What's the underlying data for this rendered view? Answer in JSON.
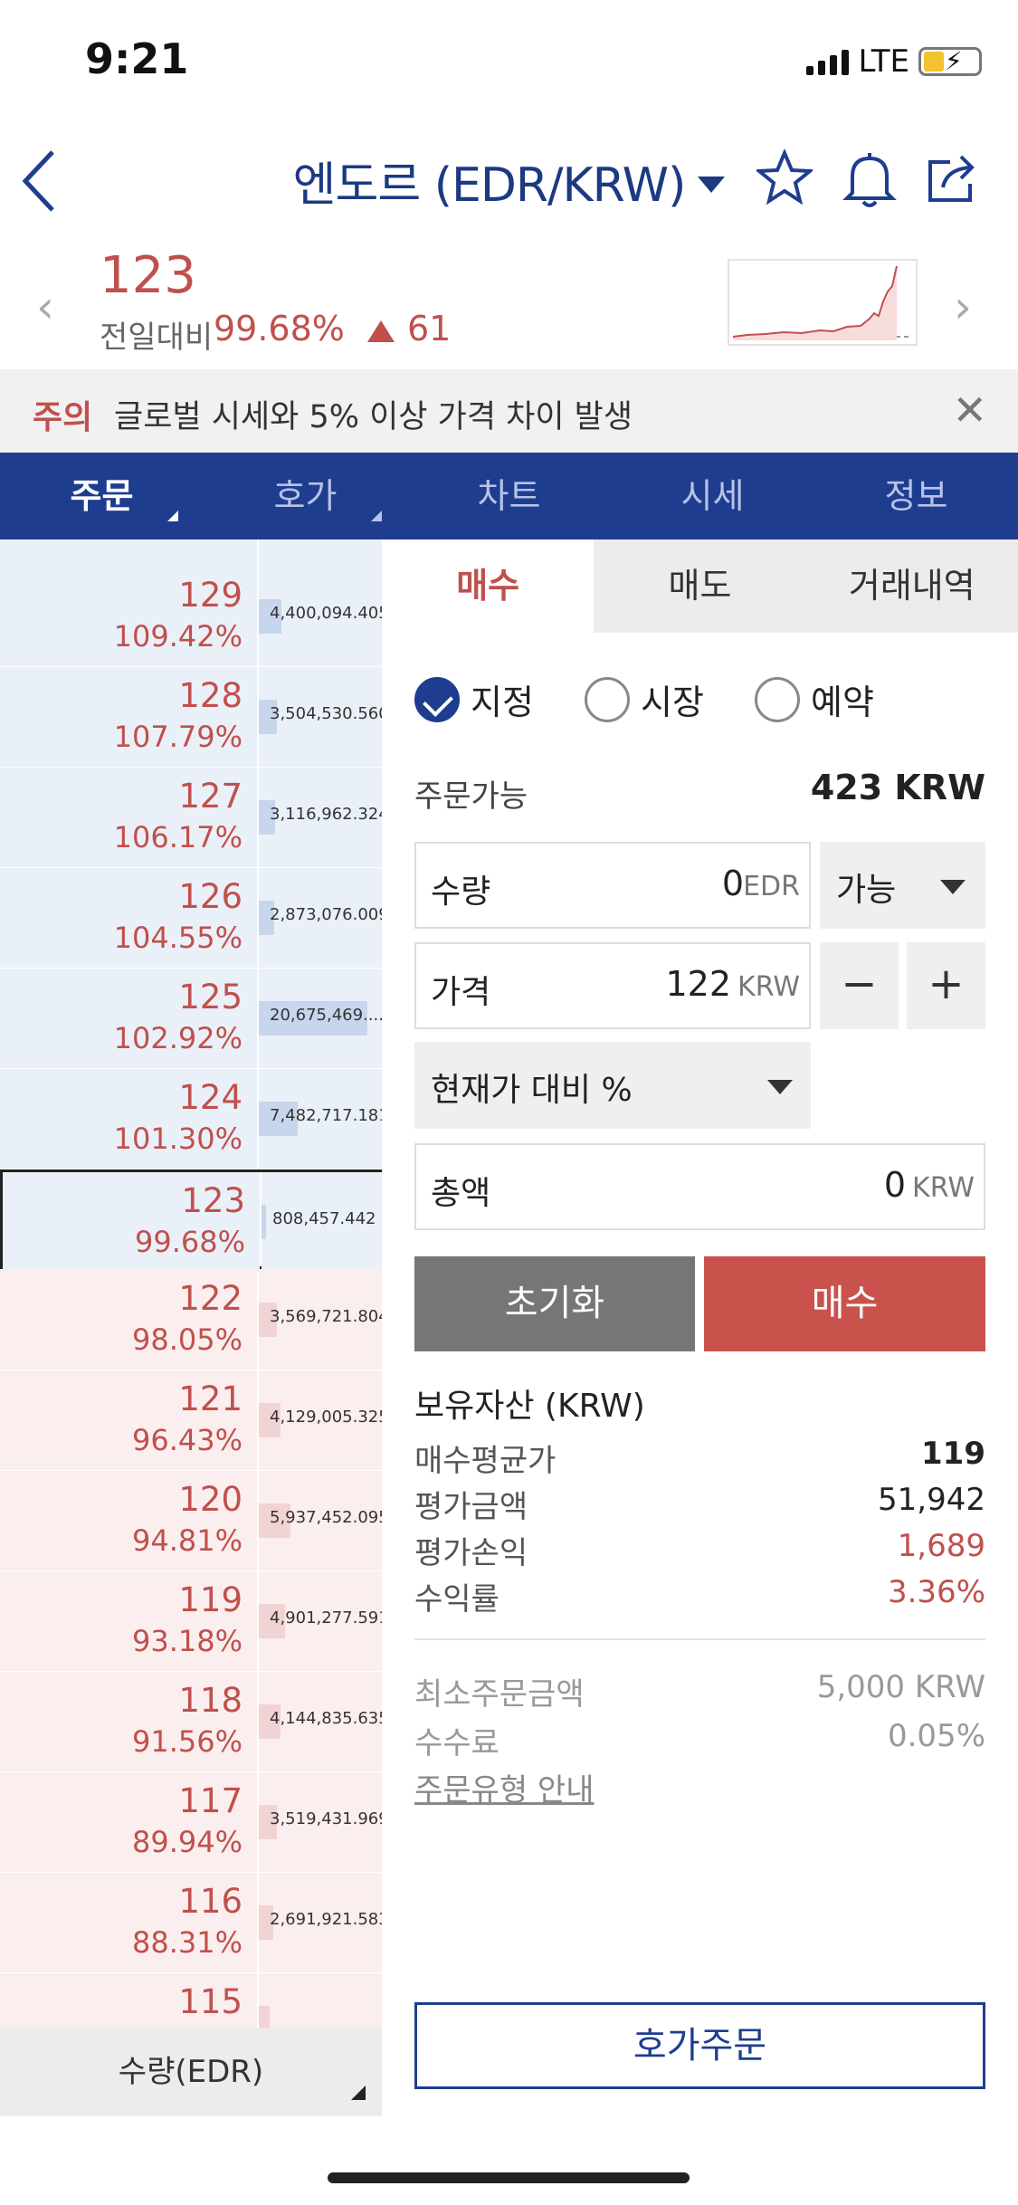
{
  "status_bar": {
    "time": "9:21",
    "network": "LTE"
  },
  "header": {
    "title": "엔도르 (EDR/KRW)"
  },
  "price_summary": {
    "price": "123",
    "change_label": "전일대비",
    "change_pct": "99.68%",
    "change_value": "61"
  },
  "notice": {
    "tag": "주의",
    "text": "글로벌 시세와 5% 이상 가격 차이 발생"
  },
  "main_tabs": [
    {
      "label": "주문"
    },
    {
      "label": "호가"
    },
    {
      "label": "차트"
    },
    {
      "label": "시세"
    },
    {
      "label": "정보"
    }
  ],
  "orderbook": {
    "asks": [
      {
        "price": "129",
        "pct": "109.42%",
        "volume": "4,400,094.405",
        "level": 0.21
      },
      {
        "price": "128",
        "pct": "107.79%",
        "volume": "3,504,530.560",
        "level": 0.17
      },
      {
        "price": "127",
        "pct": "106.17%",
        "volume": "3,116,962.324",
        "level": 0.15
      },
      {
        "price": "126",
        "pct": "104.55%",
        "volume": "2,873,076.009",
        "level": 0.14
      },
      {
        "price": "125",
        "pct": "102.92%",
        "volume": "20,675,469....",
        "level": 1.0
      },
      {
        "price": "124",
        "pct": "101.30%",
        "volume": "7,482,717.181",
        "level": 0.36
      },
      {
        "price": "123",
        "pct": "99.68%",
        "volume": "808,457.442",
        "level": 0.04
      }
    ],
    "bids": [
      {
        "price": "122",
        "pct": "98.05%",
        "volume": "3,569,721.804",
        "level": 0.17
      },
      {
        "price": "121",
        "pct": "96.43%",
        "volume": "4,129,005.325",
        "level": 0.2
      },
      {
        "price": "120",
        "pct": "94.81%",
        "volume": "5,937,452.095",
        "level": 0.29
      },
      {
        "price": "119",
        "pct": "93.18%",
        "volume": "4,901,277.591",
        "level": 0.24
      },
      {
        "price": "118",
        "pct": "91.56%",
        "volume": "4,144,835.635",
        "level": 0.2
      },
      {
        "price": "117",
        "pct": "89.94%",
        "volume": "3,519,431.969",
        "level": 0.17
      },
      {
        "price": "116",
        "pct": "88.31%",
        "volume": "2,691,921.583",
        "level": 0.13
      },
      {
        "price": "115",
        "pct": "",
        "volume": "",
        "level": 0.1
      }
    ],
    "footer": "수량(EDR)"
  },
  "order_panel": {
    "subtabs": [
      {
        "label": "매수"
      },
      {
        "label": "매도"
      },
      {
        "label": "거래내역"
      }
    ],
    "order_types": [
      {
        "label": "지정"
      },
      {
        "label": "시장"
      },
      {
        "label": "예약"
      }
    ],
    "available_label": "주문가능",
    "available_value": "423 KRW",
    "qty_label": "수량",
    "qty_value": "0",
    "qty_unit": "EDR",
    "possible_label": "가능",
    "price_label": "가격",
    "price_value": "122",
    "price_unit": "KRW",
    "minus": "−",
    "plus": "+",
    "pct_select": "현재가 대비 %",
    "total_label": "총액",
    "total_value": "0",
    "total_unit": "KRW",
    "reset_label": "초기화",
    "buy_label": "매수",
    "holdings_title": "보유자산 (KRW)",
    "holdings": [
      {
        "label": "매수평균가",
        "value": "119"
      },
      {
        "label": "평가금액",
        "value": "51,942"
      },
      {
        "label": "평가손익",
        "value": "1,689"
      },
      {
        "label": "수익률",
        "value": "3.36%"
      }
    ],
    "min_order_label": "최소주문금액",
    "min_order_value": "5,000 KRW",
    "fee_label": "수수료",
    "fee_value": "0.05%",
    "guide_link": "주문유형 안내",
    "hoga_order_label": "호가주문"
  },
  "colors": {
    "brand": "#1e3d8f",
    "up": "#c0504d",
    "buy_button": "#c9524d"
  }
}
